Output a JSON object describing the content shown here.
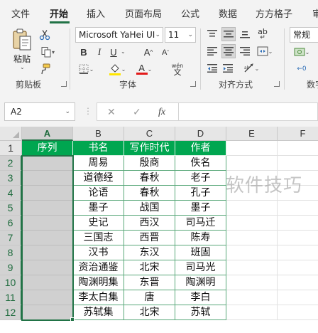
{
  "ribbon_tabs": [
    "文件",
    "开始",
    "插入",
    "页面布局",
    "公式",
    "数据",
    "方方格子",
    "审"
  ],
  "active_tab": "开始",
  "clipboard": {
    "paste_label": "粘贴",
    "group_label": "剪贴板"
  },
  "font": {
    "family": "Microsoft YaHei UI",
    "size": "11",
    "bold": "B",
    "italic": "I",
    "underline": "U",
    "grow": "A",
    "shrink": "A",
    "font_color_label": "A",
    "phonetic": "wén",
    "group_label": "字体"
  },
  "alignment": {
    "wrap_label": "ab",
    "group_label": "对齐方式"
  },
  "number": {
    "format": "常规",
    "group_label": "数字"
  },
  "formula_bar": {
    "cell_ref": "A2",
    "fx": "fx",
    "formula": ""
  },
  "columns": [
    "A",
    "B",
    "C",
    "D",
    "E",
    "F"
  ],
  "selected_column": "A",
  "rows": [
    "1",
    "2",
    "3",
    "4",
    "5",
    "6",
    "7",
    "8",
    "9",
    "10",
    "11",
    "12"
  ],
  "selected_rows": [
    "2",
    "3",
    "4",
    "5",
    "6",
    "7",
    "8",
    "9",
    "10",
    "11",
    "12"
  ],
  "table": {
    "headers": [
      "序列",
      "书名",
      "写作时代",
      "作者"
    ],
    "rows": [
      [
        "",
        "周易",
        "殷商",
        "佚名"
      ],
      [
        "",
        "道德经",
        "春秋",
        "老子"
      ],
      [
        "",
        "论语",
        "春秋",
        "孔子"
      ],
      [
        "",
        "墨子",
        "战国",
        "墨子"
      ],
      [
        "",
        "史记",
        "西汉",
        "司马迁"
      ],
      [
        "",
        "三国志",
        "西晋",
        "陈寿"
      ],
      [
        "",
        "汉书",
        "东汉",
        "班固"
      ],
      [
        "",
        "资治通鉴",
        "北宋",
        "司马光"
      ],
      [
        "",
        "陶渊明集",
        "东晋",
        "陶渊明"
      ],
      [
        "",
        "李太白集",
        "唐",
        "李白"
      ],
      [
        "",
        "苏轼集",
        "北宋",
        "苏轼"
      ]
    ]
  },
  "watermark": "软件技巧",
  "colors": {
    "accent": "#217346",
    "header_fill": "#00a650",
    "selection_fill": "#d0d0d0"
  }
}
